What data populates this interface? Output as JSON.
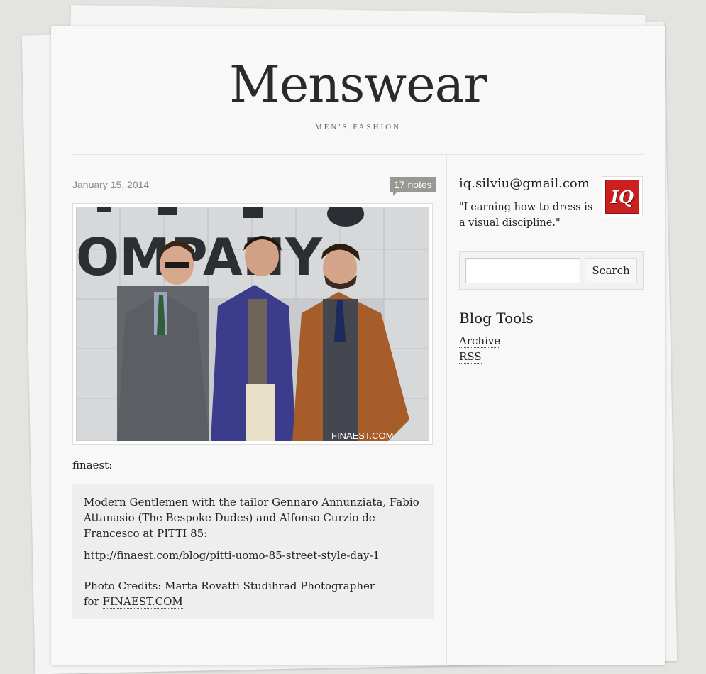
{
  "blog": {
    "title": "Menswear",
    "tagline": "MEN'S FASHION"
  },
  "post": {
    "date": "January 15, 2014",
    "notes": "17 notes",
    "source_label": "finaest:",
    "quote_text": "Modern Gentlemen with the tailor Gennaro Annunziata, Fabio Attanasio (The Bespoke Dudes) and Alfonso Curzio de Francesco at PITTI 85:",
    "quote_link": "http://finaest.com/blog/pitti-uomo-85-street-style-day-1",
    "credits_text": "Photo Credits: Marta Rovatti Studihrad Photographer",
    "credits_prefix": "for",
    "credits_link": "FINAEST.COM",
    "photo_watermark": "FINAEST.COM"
  },
  "sidebar": {
    "email": "iq.silviu@gmail.com",
    "description": "\"Learning how to dress is a visual discipline.\"",
    "avatar_text": "IQ",
    "search_button": "Search",
    "search_value": "",
    "tools_title": "Blog Tools",
    "tools": [
      {
        "label": "Archive"
      },
      {
        "label": "RSS"
      }
    ]
  },
  "colors": {
    "background": "#e3e3e0",
    "page": "#f8f8f8",
    "notes_badge": "#999893",
    "avatar": "#cc1f1f"
  }
}
